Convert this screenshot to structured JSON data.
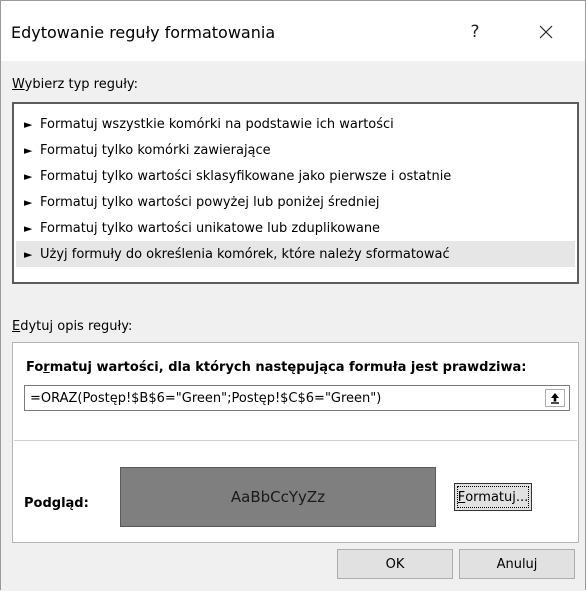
{
  "dialog": {
    "title": "Edytowanie reguły formatowania",
    "help_label": "?",
    "close_label": "✕"
  },
  "rule_type": {
    "label_prefix": "W",
    "label_rest": "ybierz typ reguły:",
    "items": [
      {
        "arrow": "►",
        "label": "Formatuj wszystkie komórki na podstawie ich wartości"
      },
      {
        "arrow": "►",
        "label": "Formatuj tylko komórki zawierające"
      },
      {
        "arrow": "►",
        "label": "Formatuj tylko wartości sklasyfikowane jako pierwsze i ostatnie"
      },
      {
        "arrow": "►",
        "label": "Formatuj tylko wartości powyżej lub poniżej średniej"
      },
      {
        "arrow": "►",
        "label": "Formatuj tylko wartości unikatowe lub zduplikowane"
      },
      {
        "arrow": "►",
        "label": "Użyj formuły do określenia komórek, które należy sformatować"
      }
    ],
    "selected_index": 5
  },
  "edit_description": {
    "label_prefix": "E",
    "label_rest": "dytuj opis reguły:",
    "formula_heading_a": "Fo",
    "formula_heading_u": "r",
    "formula_heading_b": "matuj wartości, dla których następująca formuła jest prawdziwa:",
    "formula_value": "=ORAZ(Postęp!$B$6=\"Green\";Postęp!$C$6=\"Green\")",
    "collapse_icon": "upload-arrow",
    "preview_label": "Podgląd:",
    "preview_text": "AaBbCcYyZz",
    "preview_fill": "#7f7f7f",
    "format_button_u": "F",
    "format_button_rest": "ormatuj..."
  },
  "buttons": {
    "ok": "OK",
    "cancel": "Anuluj"
  }
}
